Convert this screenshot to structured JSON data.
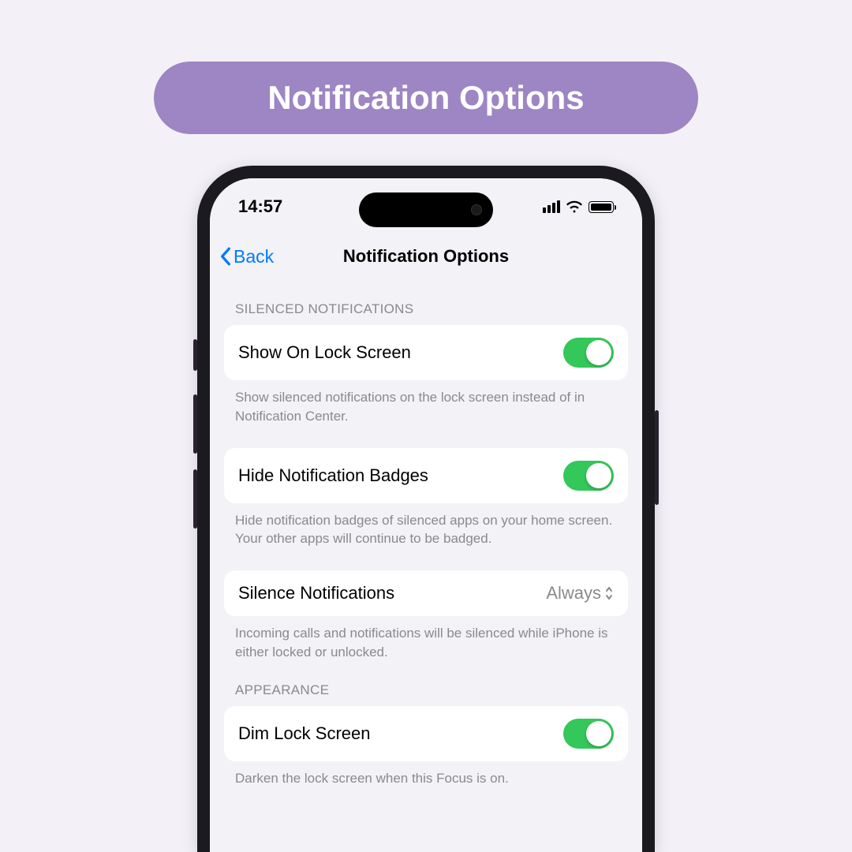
{
  "banner": {
    "title": "Notification Options"
  },
  "status": {
    "time": "14:57"
  },
  "nav": {
    "back": "Back",
    "title": "Notification Options"
  },
  "sections": {
    "silenced": {
      "header": "SILENCED NOTIFICATIONS",
      "show_lock": {
        "label": "Show On Lock Screen",
        "on": true
      },
      "show_lock_footer": "Show silenced notifications on the lock screen instead of in Notification Center.",
      "hide_badges": {
        "label": "Hide Notification Badges",
        "on": true
      },
      "hide_badges_footer": "Hide notification badges of silenced apps on your home screen. Your other apps will continue to be badged.",
      "silence": {
        "label": "Silence Notifications",
        "value": "Always"
      },
      "silence_footer": "Incoming calls and notifications will be silenced while iPhone is either locked or unlocked."
    },
    "appearance": {
      "header": "APPEARANCE",
      "dim": {
        "label": "Dim Lock Screen",
        "on": true
      },
      "dim_footer": "Darken the lock screen when this Focus is on."
    }
  }
}
